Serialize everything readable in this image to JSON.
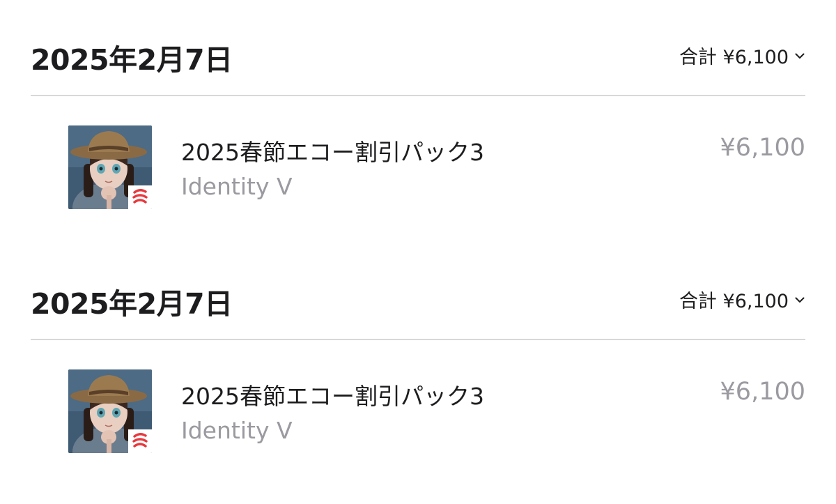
{
  "purchases": [
    {
      "date": "2025年2月7日",
      "total_label": "合計 ¥6,100",
      "items": [
        {
          "title": "2025春節エコー割引パック3",
          "app_name": "Identity V",
          "price": "¥6,100"
        }
      ]
    },
    {
      "date": "2025年2月7日",
      "total_label": "合計 ¥6,100",
      "items": [
        {
          "title": "2025春節エコー割引パック3",
          "app_name": "Identity V",
          "price": "¥6,100"
        }
      ]
    }
  ],
  "icons": {
    "expand": "chevron-down-icon",
    "app": "identity-v-app-icon",
    "publisher_badge": "netease-badge-icon"
  },
  "colors": {
    "text_primary": "#1d1d1f",
    "text_secondary": "#9a9aa0",
    "divider": "#d8d8da",
    "badge_red": "#e8383d"
  }
}
